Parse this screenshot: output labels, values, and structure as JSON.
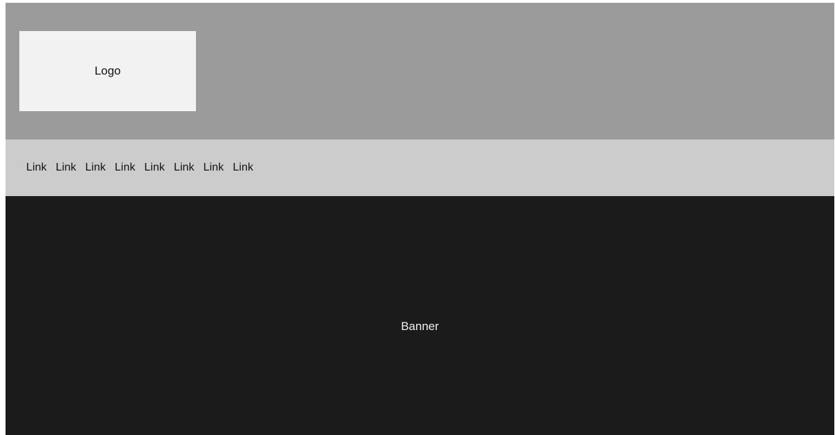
{
  "header": {
    "logo_label": "Logo",
    "background": "#9b9b9b",
    "logo_background": "#f2f2f2"
  },
  "nav": {
    "background": "#cccccc",
    "links": [
      {
        "label": "Link"
      },
      {
        "label": "Link"
      },
      {
        "label": "Link"
      },
      {
        "label": "Link"
      },
      {
        "label": "Link"
      },
      {
        "label": "Link"
      },
      {
        "label": "Link"
      },
      {
        "label": "Link"
      }
    ]
  },
  "banner": {
    "label": "Banner",
    "background": "#1b1b1b"
  }
}
